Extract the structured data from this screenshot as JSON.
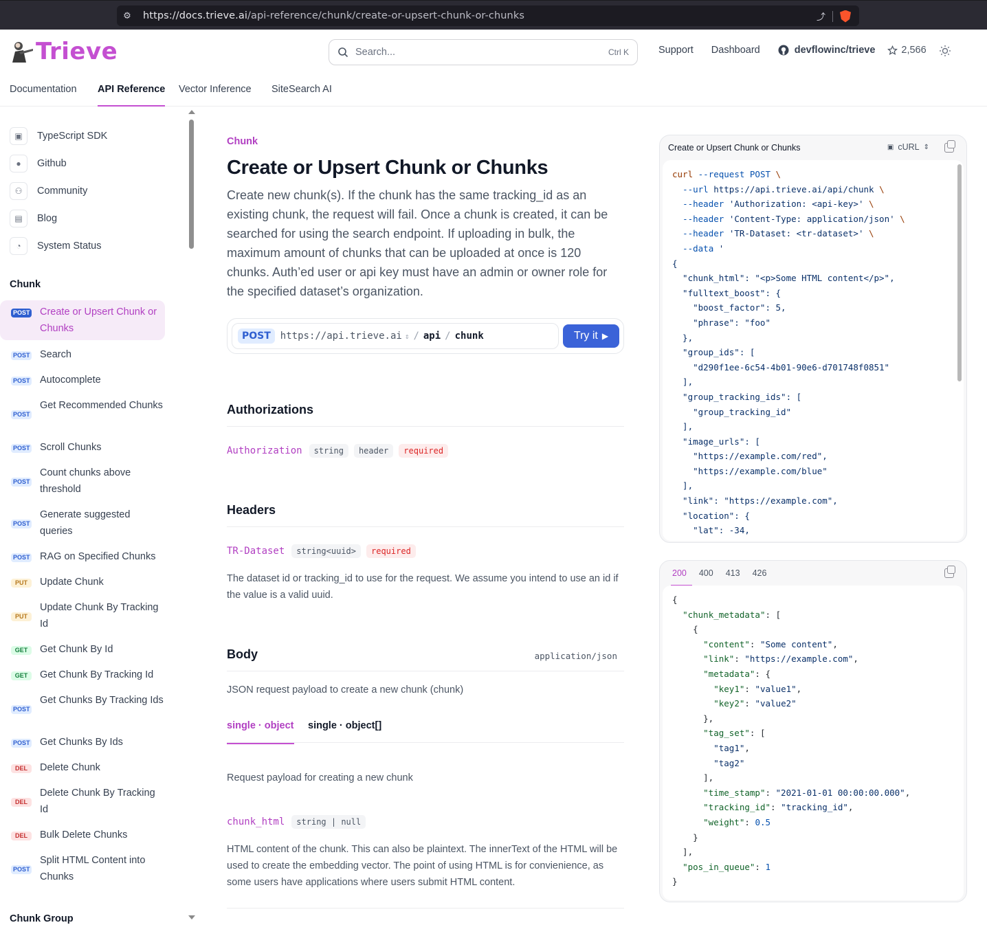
{
  "browser": {
    "url_host": "https://docs.trieve.ai",
    "url_path": "/api-reference/chunk/create-or-upsert-chunk-or-chunks"
  },
  "header": {
    "logo_text": "Trieve",
    "search_placeholder": "Search...",
    "search_shortcut": "Ctrl K",
    "support": "Support",
    "dashboard": "Dashboard",
    "repo": "devflowinc/trieve",
    "stars": "2,566"
  },
  "nav": {
    "tabs": [
      "Documentation",
      "API Reference",
      "Vector Inference",
      "SiteSearch AI"
    ],
    "active": "API Reference"
  },
  "sidebar": {
    "resources": [
      "TypeScript SDK",
      "Github",
      "Community",
      "Blog",
      "System Status"
    ],
    "section_chunk": "Chunk",
    "items": [
      {
        "method": "POST",
        "label": "Create or Upsert Chunk or Chunks"
      },
      {
        "method": "POST",
        "label": "Search"
      },
      {
        "method": "POST",
        "label": "Autocomplete"
      },
      {
        "method": "POST",
        "label": "Get Recommended Chunks"
      },
      {
        "method": "POST",
        "label": "Scroll Chunks"
      },
      {
        "method": "POST",
        "label": "Count chunks above threshold"
      },
      {
        "method": "POST",
        "label": "Generate suggested queries"
      },
      {
        "method": "POST",
        "label": "RAG on Specified Chunks"
      },
      {
        "method": "PUT",
        "label": "Update Chunk"
      },
      {
        "method": "PUT",
        "label": "Update Chunk By Tracking Id"
      },
      {
        "method": "GET",
        "label": "Get Chunk By Id"
      },
      {
        "method": "GET",
        "label": "Get Chunk By Tracking Id"
      },
      {
        "method": "POST",
        "label": "Get Chunks By Tracking Ids"
      },
      {
        "method": "POST",
        "label": "Get Chunks By Ids"
      },
      {
        "method": "DEL",
        "label": "Delete Chunk"
      },
      {
        "method": "DEL",
        "label": "Delete Chunk By Tracking Id"
      },
      {
        "method": "DEL",
        "label": "Bulk Delete Chunks"
      },
      {
        "method": "POST",
        "label": "Split HTML Content into Chunks"
      }
    ],
    "section_chunk_group": "Chunk Group"
  },
  "main": {
    "breadcrumb": "Chunk",
    "title": "Create or Upsert Chunk or Chunks",
    "description": "Create new chunk(s). If the chunk has the same tracking_id as an existing chunk, the request will fail. Once a chunk is created, it can be searched for using the search endpoint. If uploading in bulk, the maximum amount of chunks that can be uploaded at once is 120 chunks. Auth’ed user or api key must have an admin or owner role for the specified dataset’s organization.",
    "endpoint": {
      "method": "POST",
      "base": "https://api.trieve.ai",
      "seg1": "api",
      "seg2": "chunk",
      "try_label": "Try it"
    },
    "authorizations": {
      "heading": "Authorizations",
      "name": "Authorization",
      "type": "string",
      "location": "header",
      "required": "required"
    },
    "headers": {
      "heading": "Headers",
      "name": "TR-Dataset",
      "type": "string<uuid>",
      "required": "required",
      "description": "The dataset id or tracking_id to use for the request. We assume you intend to use an id if the value is a valid uuid."
    },
    "body": {
      "heading": "Body",
      "content_type": "application/json",
      "description": "JSON request payload to create a new chunk (chunk)",
      "tab1": "single · object",
      "tab2": "single · object[]",
      "payload_desc": "Request payload for creating a new chunk",
      "field_name": "chunk_html",
      "field_type": "string | null",
      "field_desc": "HTML content of the chunk. This can also be plaintext. The innerText of the HTML will be used to create the embedding vector. The point of using HTML is for convienience, as some users have applications where users submit HTML content."
    }
  },
  "request_panel": {
    "title": "Create or Upsert Chunk or Chunks",
    "language": "cURL"
  },
  "response_panel": {
    "tabs": [
      "200",
      "400",
      "413",
      "426"
    ],
    "active": "200"
  },
  "colors": {
    "brand": "#c44fd1",
    "try_button": "#3b63d8"
  }
}
